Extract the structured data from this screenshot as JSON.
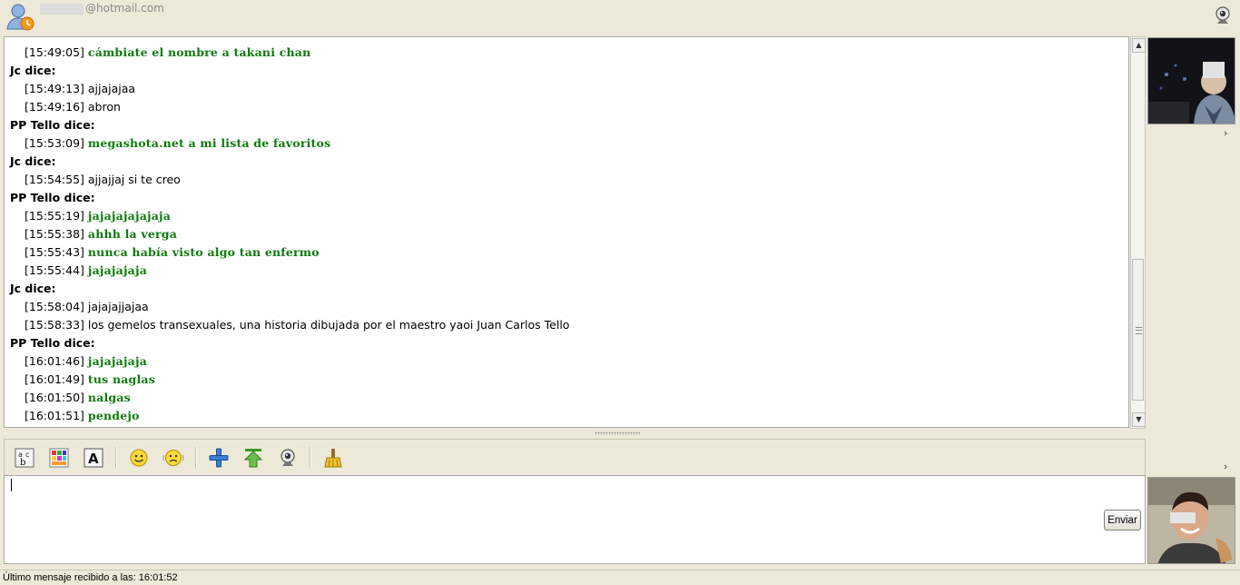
{
  "header": {
    "email_suffix": "@hotmail.com",
    "avatar_icon": "user-buddy-icon",
    "webcam_icon": "webcam-icon"
  },
  "chat": {
    "pp_color": "#0d7a0d",
    "lines": [
      {
        "kind": "msg",
        "who": "pp",
        "time": "[15:49:05]",
        "text": "cámbiate el nombre a takani chan"
      },
      {
        "kind": "sender",
        "text": "Jc dice:"
      },
      {
        "kind": "msg",
        "who": "jc",
        "time": "[15:49:13]",
        "text": "ajjajajaa"
      },
      {
        "kind": "msg",
        "who": "jc",
        "time": "[15:49:16]",
        "text": "abron"
      },
      {
        "kind": "sender",
        "text": "PP Tello dice:"
      },
      {
        "kind": "msg",
        "who": "pp",
        "time": "[15:53:09]",
        "text": "megashota.net a mi lista de favoritos"
      },
      {
        "kind": "sender",
        "text": "Jc dice:"
      },
      {
        "kind": "msg",
        "who": "jc",
        "time": "[15:54:55]",
        "text": "ajjajjaj si te creo"
      },
      {
        "kind": "sender",
        "text": "PP Tello dice:"
      },
      {
        "kind": "msg",
        "who": "pp",
        "time": "[15:55:19]",
        "text": "jajajajajajaja"
      },
      {
        "kind": "msg",
        "who": "pp",
        "time": "[15:55:38]",
        "text": "ahhh la verga"
      },
      {
        "kind": "msg",
        "who": "pp",
        "time": "[15:55:43]",
        "text": "nunca había visto algo tan enfermo"
      },
      {
        "kind": "msg",
        "who": "pp",
        "time": "[15:55:44]",
        "text": "jajajajaja"
      },
      {
        "kind": "sender",
        "text": "Jc dice:"
      },
      {
        "kind": "msg",
        "who": "jc",
        "time": "[15:58:04]",
        "text": "jajajajjajaa"
      },
      {
        "kind": "msg",
        "who": "jc",
        "time": "[15:58:33]",
        "text": "los gemelos transexuales, una historia dibujada por el maestro yaoi Juan Carlos Tello"
      },
      {
        "kind": "sender",
        "text": "PP Tello dice:"
      },
      {
        "kind": "msg",
        "who": "pp",
        "time": "[16:01:46]",
        "text": "jajajajaja"
      },
      {
        "kind": "msg",
        "who": "pp",
        "time": "[16:01:49]",
        "text": "tus naglas"
      },
      {
        "kind": "msg",
        "who": "pp",
        "time": "[16:01:50]",
        "text": "nalgas"
      },
      {
        "kind": "msg",
        "who": "pp",
        "time": "[16:01:51]",
        "text": "pendejo"
      }
    ]
  },
  "toolbar": {
    "tools": [
      "font-abc-icon",
      "color-palette-icon",
      "text-format-icon",
      "smiley-icon",
      "wink-emoticon-icon",
      "add-contact-icon",
      "send-file-icon",
      "webcam-icon",
      "clear-broom-icon"
    ]
  },
  "compose": {
    "send_label": "Enviar"
  },
  "sidebar": {
    "chevron": "›"
  },
  "status": {
    "text": "Último mensaje recibido a las:  16:01:52"
  }
}
